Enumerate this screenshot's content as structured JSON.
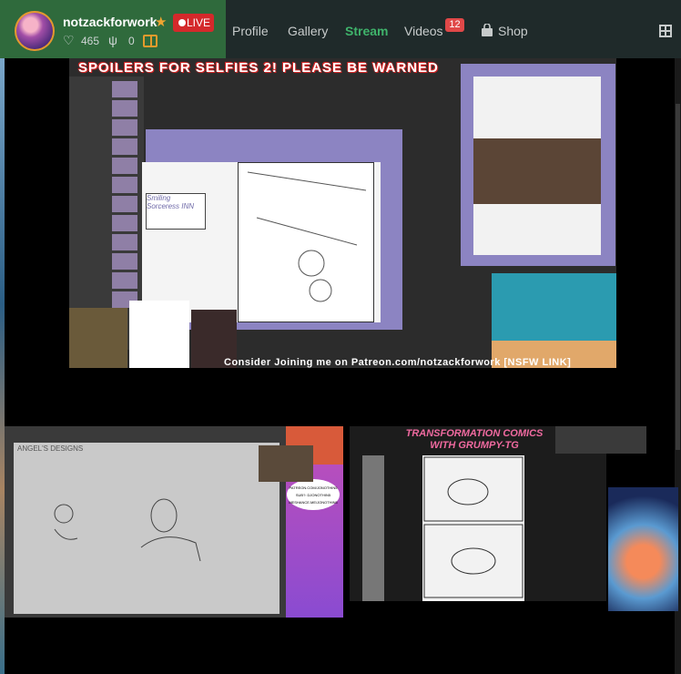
{
  "header": {
    "username": "notzackforwork",
    "live_label": "LIVE",
    "followers": "465",
    "gifts": "0",
    "nav": [
      {
        "label": "Profile"
      },
      {
        "label": "Gallery"
      },
      {
        "label": "Stream"
      },
      {
        "label": "Videos"
      },
      {
        "label": "Shop"
      }
    ],
    "videos_badge": "12",
    "active_tab": "Stream"
  },
  "streams": {
    "main": {
      "title": "SPOILERS FOR SELFIES 2! PLEASE BE WARNED",
      "banner": "Consider Joining me on Patreon.com/notzackforwork [NSFW LINK]",
      "sign": "Smiling Sorceress INN"
    },
    "second": {
      "note": "ANGEL'S DESIGNS",
      "bubble": "PATREON.COM/JONOTHIN5 SUB?: DJONOTHIN5 MESHANCE.ME/JONOTHIN5"
    },
    "third": {
      "title": "TRANSFORMATION COMICS WITH GRUMPY-TG"
    }
  },
  "colors": {
    "accent_green": "#3fb36b",
    "live_red": "#d4292b",
    "badge_red": "#e04848",
    "star": "#f0a531",
    "comic_pink": "#f06aa0"
  }
}
